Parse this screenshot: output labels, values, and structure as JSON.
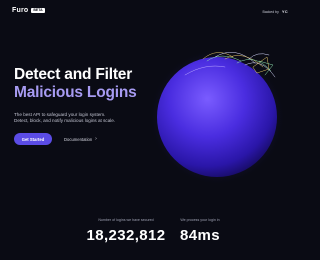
{
  "header": {
    "logo_text": "Furo",
    "logo_badge": "BETA",
    "backed_label": "Backed by",
    "backed_name": "YC"
  },
  "hero": {
    "headline_line1": "Detect and Filter",
    "headline_line2": "Malicious Logins",
    "subtitle_line1": "The best API to safeguard your login system.",
    "subtitle_line2": "Detect, block, and notify malicious logins at scale."
  },
  "actions": {
    "primary_label": "Get Started",
    "secondary_label": "Documentation",
    "secondary_arrow": "›"
  },
  "stats": {
    "stat1_label": "Number of logins we have secured",
    "stat1_value": "18,232,812",
    "stat2_label": "We process your login in",
    "stat2_value": "84ms"
  },
  "colors": {
    "background": "#0a0b14",
    "accent_text": "#a79bf2",
    "primary_button": "#5b4ce6",
    "sphere": "#4a2de0"
  },
  "icons": [
    "globe-sphere-icon",
    "chevron-right-icon"
  ]
}
